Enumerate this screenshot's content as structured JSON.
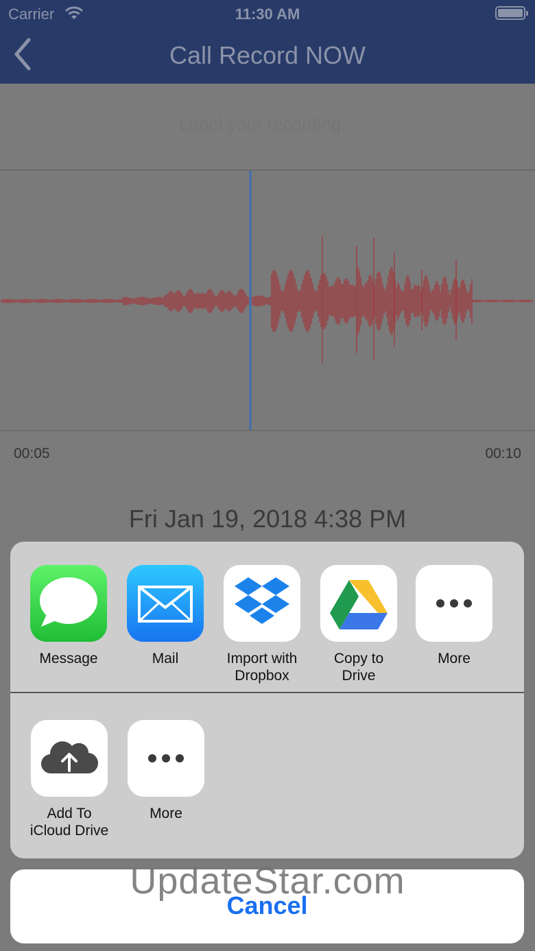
{
  "status_bar": {
    "carrier": "Carrier",
    "time": "11:30 AM"
  },
  "nav": {
    "title": "Call Record NOW"
  },
  "recording": {
    "label_placeholder": "Label your recording...",
    "time_start": "00:05",
    "time_end": "00:10",
    "date": "Fri Jan 19, 2018 4:38 PM"
  },
  "share_sheet": {
    "apps": [
      {
        "label": "Message",
        "icon": "message-icon"
      },
      {
        "label": "Mail",
        "icon": "mail-icon"
      },
      {
        "label": "Import with\nDropbox",
        "icon": "dropbox-icon"
      },
      {
        "label": "Copy to\nDrive",
        "icon": "google-drive-icon"
      },
      {
        "label": "More",
        "icon": "more-icon"
      }
    ],
    "actions": [
      {
        "label": "Add To\niCloud Drive",
        "icon": "icloud-upload-icon"
      },
      {
        "label": "More",
        "icon": "more-icon"
      }
    ],
    "cancel_label": "Cancel"
  },
  "watermark": "UpdateStar.com",
  "colors": {
    "nav_bg": "#283a68",
    "waveform": "#9c3f41",
    "playhead": "#3e6fb0",
    "accent": "#1a6ff0"
  }
}
